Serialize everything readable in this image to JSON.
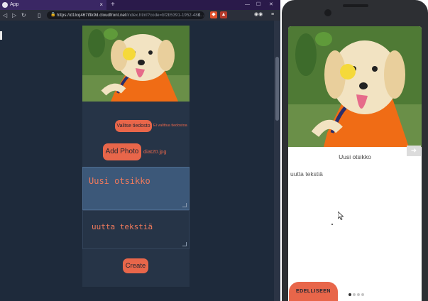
{
  "browser": {
    "tab_title": "App",
    "url_host": "https://d1lcq467iftk9d.cloudfront.net",
    "url_path": "/index.html?code=bf2b5391-1952-48d..."
  },
  "form": {
    "choose_file_label": "Valitse tiedosto",
    "no_file_label": "Ei valittua tiedostoa",
    "add_photo_label": "Add Photo",
    "file_name": "diat20.jpg",
    "title_value": "Uusi otsikko",
    "body_value": "uutta tekstiä",
    "create_label": "Create"
  },
  "phone": {
    "title": "Uusi otsikko",
    "body": "uutta tekstiä",
    "prev_label": "EDELLISEEN",
    "pager": {
      "total": 4,
      "active": 0
    }
  },
  "colors": {
    "accent": "#e8664a",
    "page_bg": "#1e2a3b",
    "panel": "#263447",
    "title_box": "#3c5879"
  }
}
